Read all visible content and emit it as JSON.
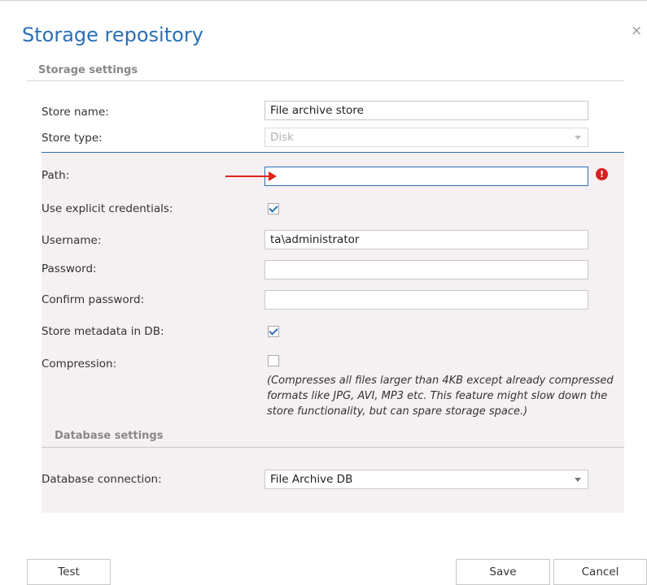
{
  "dialog": {
    "title": "Storage repository",
    "close_glyph": "×"
  },
  "storage_settings": {
    "header": "Storage settings",
    "store_name": {
      "label": "Store name:",
      "value": "File archive store"
    },
    "store_type": {
      "label": "Store type:",
      "value": "Disk"
    },
    "path": {
      "label": "Path:",
      "value": "",
      "error": true
    },
    "use_explicit_credentials": {
      "label": "Use explicit credentials:",
      "checked": true
    },
    "username": {
      "label": "Username:",
      "value": "ta\\administrator"
    },
    "password": {
      "label": "Password:",
      "value": ""
    },
    "confirm_password": {
      "label": "Confirm password:",
      "value": ""
    },
    "store_metadata": {
      "label": "Store metadata in DB:",
      "checked": true
    },
    "compression": {
      "label": "Compression:",
      "checked": false,
      "note": "(Compresses all files larger than 4KB except already compressed formats like JPG, AVI, MP3 etc. This feature might slow down the store functionality, but can spare storage space.)"
    }
  },
  "database_settings": {
    "header": "Database settings",
    "connection": {
      "label": "Database connection:",
      "value": "File Archive DB"
    }
  },
  "buttons": {
    "test": "Test",
    "save": "Save",
    "cancel": "Cancel"
  },
  "colors": {
    "accent": "#2b6fb6",
    "error": "#d62020",
    "annotation_arrow": "#e2231a",
    "panel_background": "#f5f0f2"
  },
  "icons": {
    "close": "close-icon",
    "error": "error-icon",
    "dropdown": "chevron-down-icon",
    "check": "checkmark-icon"
  }
}
